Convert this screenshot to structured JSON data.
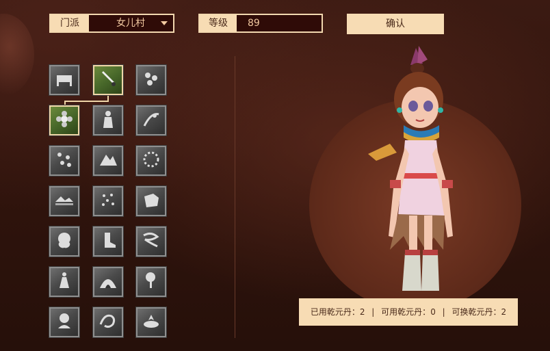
{
  "sect": {
    "label": "门派",
    "value": "女儿村"
  },
  "level": {
    "label": "等级",
    "value": "89"
  },
  "confirm_label": "确认",
  "pill_status": {
    "used_label": "已用乾元丹：",
    "used_value": "2",
    "sep": "|",
    "available_label": "可用乾元丹：",
    "available_value": "0",
    "exchangeable_label": "可换乾元丹：",
    "exchangeable_value": "2"
  },
  "skills": [
    {
      "icon": "bed-icon",
      "state": "inactive"
    },
    {
      "icon": "dagger-icon",
      "state": "active"
    },
    {
      "icon": "flower-cluster-icon",
      "state": "inactive"
    },
    {
      "icon": "blossom-icon",
      "state": "active"
    },
    {
      "icon": "standing-lady-icon",
      "state": "inactive"
    },
    {
      "icon": "vine-icon",
      "state": "inactive"
    },
    {
      "icon": "scattered-stones-icon",
      "state": "inactive"
    },
    {
      "icon": "mountain-rock-icon",
      "state": "inactive"
    },
    {
      "icon": "ring-of-flowers-icon",
      "state": "inactive"
    },
    {
      "icon": "lake-mountain-icon",
      "state": "inactive"
    },
    {
      "icon": "petals-icon",
      "state": "inactive"
    },
    {
      "icon": "stone-block-icon",
      "state": "inactive"
    },
    {
      "icon": "cloud-emblem-icon",
      "state": "inactive"
    },
    {
      "icon": "boot-icon",
      "state": "inactive"
    },
    {
      "icon": "swirl-wind-icon",
      "state": "inactive"
    },
    {
      "icon": "dancer-icon",
      "state": "inactive"
    },
    {
      "icon": "cave-icon",
      "state": "inactive"
    },
    {
      "icon": "bonsai-tree-icon",
      "state": "inactive"
    },
    {
      "icon": "maiden-portrait-icon",
      "state": "inactive"
    },
    {
      "icon": "phoenix-icon",
      "state": "inactive"
    },
    {
      "icon": "lotus-pond-icon",
      "state": "inactive"
    }
  ]
}
